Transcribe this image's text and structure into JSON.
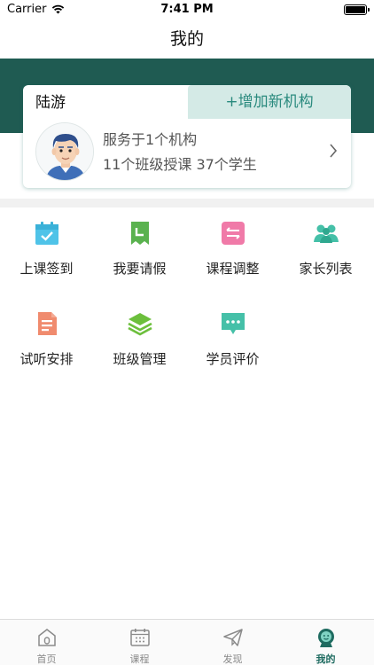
{
  "status_bar": {
    "carrier": "Carrier",
    "time": "7:41 PM"
  },
  "nav": {
    "title": "我的"
  },
  "profile": {
    "name": "陆游",
    "add_org_label": "+增加新机构",
    "service_line": "服务于1个机构",
    "stats_line": "11个班级授课  37个学生"
  },
  "grid": {
    "items": [
      {
        "label": "上课签到",
        "icon": "calendar-check-icon",
        "color": "#4fc3e8"
      },
      {
        "label": "我要请假",
        "icon": "leave-icon",
        "color": "#5ab24f"
      },
      {
        "label": "课程调整",
        "icon": "swap-icon",
        "color": "#f07aa8"
      },
      {
        "label": "家长列表",
        "icon": "parents-icon",
        "color": "#45c0a8"
      },
      {
        "label": "试听安排",
        "icon": "document-icon",
        "color": "#f08b6e"
      },
      {
        "label": "班级管理",
        "icon": "layers-icon",
        "color": "#6cbf3c"
      },
      {
        "label": "学员评价",
        "icon": "comment-icon",
        "color": "#45c0a8"
      }
    ]
  },
  "tab_bar": {
    "tabs": [
      {
        "label": "首页",
        "icon": "home-icon",
        "active": false
      },
      {
        "label": "课程",
        "icon": "schedule-icon",
        "active": false
      },
      {
        "label": "发现",
        "icon": "paper-plane-icon",
        "active": false
      },
      {
        "label": "我的",
        "icon": "profile-icon",
        "active": true
      }
    ]
  },
  "colors": {
    "brand_dark_green": "#1f5b52",
    "accent_teal": "#2a8a7e",
    "tab_active": "#1e6b60"
  }
}
